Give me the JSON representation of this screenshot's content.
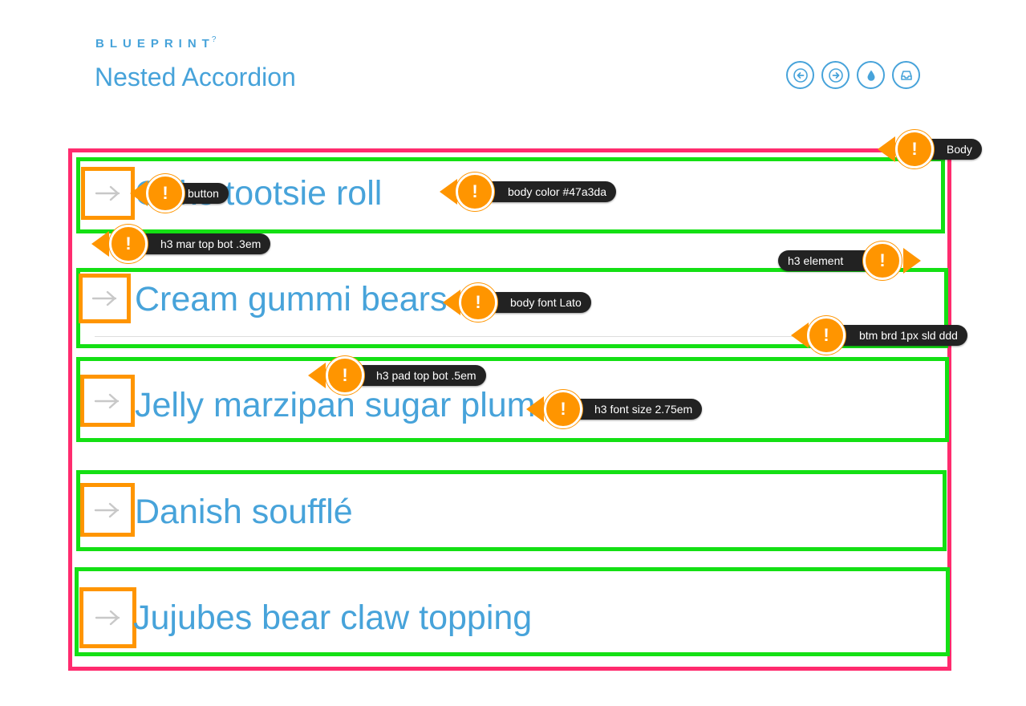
{
  "header": {
    "brand": "BLUEPRINT",
    "help_symbol": "?",
    "title": "Nested Accordion"
  },
  "nav": [
    {
      "name": "previous",
      "icon": "arrow-left-icon"
    },
    {
      "name": "next",
      "icon": "arrow-right-icon"
    },
    {
      "name": "drop",
      "icon": "drop-icon"
    },
    {
      "name": "inbox",
      "icon": "inbox-icon"
    }
  ],
  "accordion": {
    "items": [
      {
        "label": "Cake tootsie roll"
      },
      {
        "label": "Cream gummi bears"
      },
      {
        "label": "Jelly marzipan sugar plum"
      },
      {
        "label": "Danish soufflé"
      },
      {
        "label": "Jujubes bear claw topping"
      }
    ]
  },
  "annotations": [
    {
      "text": "Body"
    },
    {
      "text": "button"
    },
    {
      "text": "body color #47a3da"
    },
    {
      "text": "h3 mar top bot .3em"
    },
    {
      "text": "h3 element"
    },
    {
      "text": "body font Lato"
    },
    {
      "text": "btm brd 1px sld ddd"
    },
    {
      "text": "h3 pad top bot .5em"
    },
    {
      "text": "h3 font size 2.75em"
    }
  ],
  "colors": {
    "accent": "#47a3da",
    "body_outline": "#ff2b6e",
    "element_outline": "#14e014",
    "button_outline": "#ff9500",
    "note_badge": "#ff9500",
    "note_pill": "#222222",
    "divider": "#dddddd"
  }
}
